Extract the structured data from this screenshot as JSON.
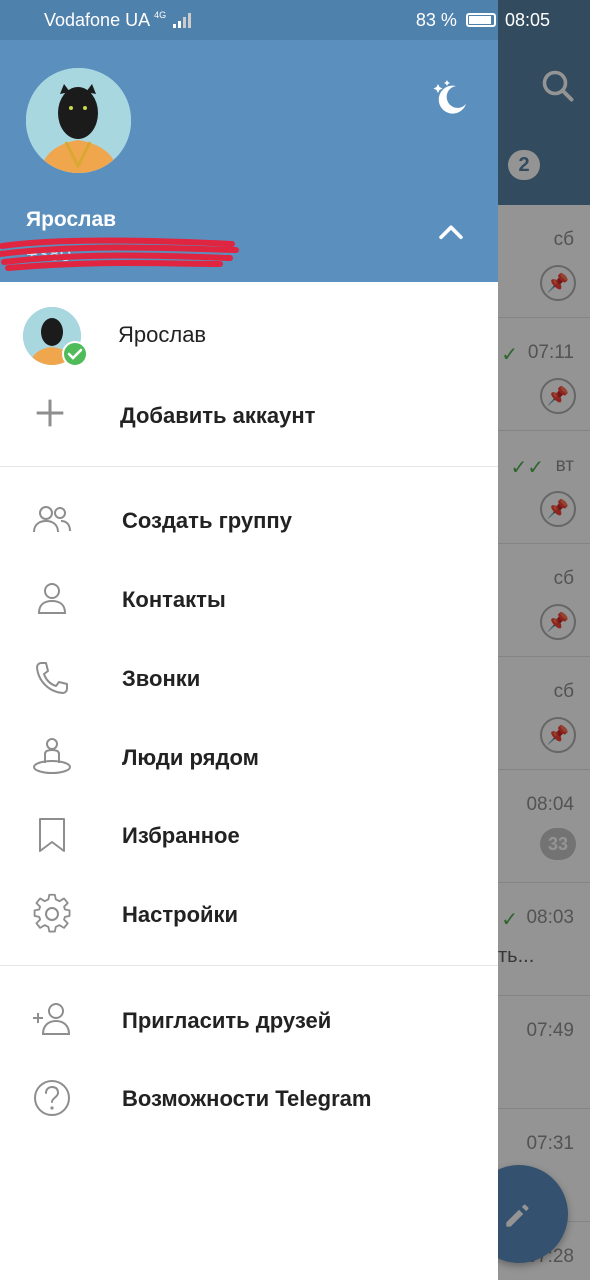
{
  "status_bar": {
    "carrier": "Vodafone UA",
    "network": "4G",
    "battery": "83 %",
    "time": "08:05"
  },
  "background": {
    "header_count": "2",
    "rows": [
      {
        "time": "сб",
        "pinned": true
      },
      {
        "time": "07:11",
        "pinned": true,
        "check": "✓"
      },
      {
        "time": "вт",
        "pinned": true,
        "check": "✓✓"
      },
      {
        "time": "сб",
        "pinned": true
      },
      {
        "time": "сб",
        "pinned": true
      },
      {
        "time": "08:04",
        "badge": "33"
      },
      {
        "time": "08:03",
        "check": "✓",
        "snippet": "ть..."
      },
      {
        "time": "07:49"
      },
      {
        "time": "07:31"
      },
      {
        "time": "07:28"
      }
    ]
  },
  "drawer": {
    "profile": {
      "name": "Ярослав",
      "phone": "+380"
    },
    "accounts": {
      "current_name": "Ярослав",
      "add_label": "Добавить аккаунт"
    },
    "menu": {
      "new_group": "Создать группу",
      "contacts": "Контакты",
      "calls": "Звонки",
      "people_nearby": "Люди рядом",
      "saved": "Избранное",
      "settings": "Настройки",
      "invite": "Пригласить друзей",
      "features": "Возможности Telegram"
    }
  },
  "colors": {
    "header": "#5b8fbe",
    "accent_check": "#4fbc59",
    "fab": "#5a8cc0"
  }
}
